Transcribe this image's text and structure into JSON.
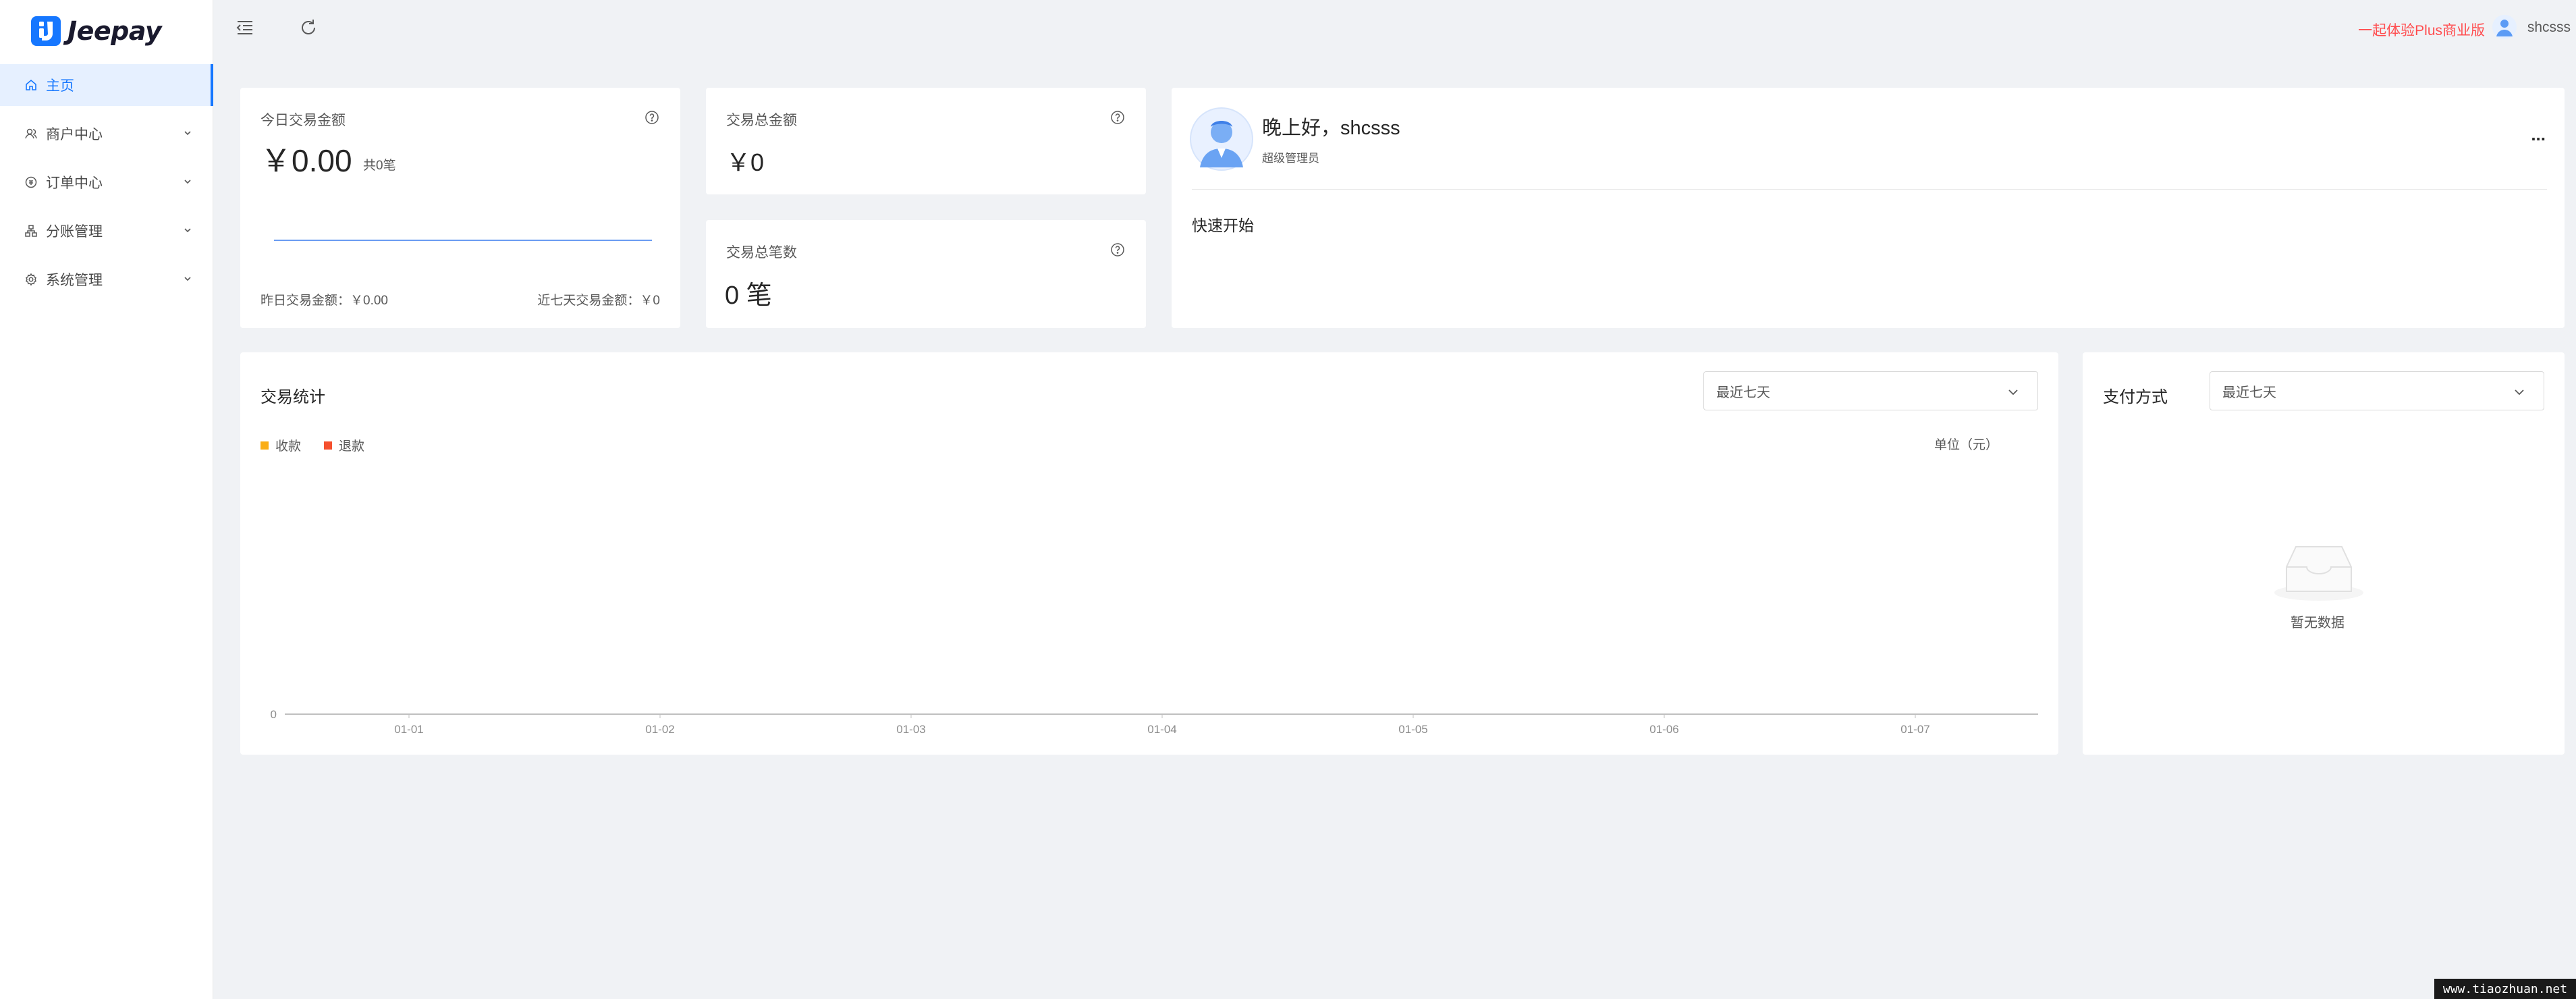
{
  "app": {
    "logo_text": "Jeepay",
    "brand_color": "#1677ff"
  },
  "sidebar": {
    "items": [
      {
        "label": "主页",
        "icon": "home-icon",
        "active": true
      },
      {
        "label": "商户中心",
        "icon": "merchant-icon",
        "expandable": true
      },
      {
        "label": "订单中心",
        "icon": "order-icon",
        "expandable": true
      },
      {
        "label": "分账管理",
        "icon": "division-icon",
        "expandable": true
      },
      {
        "label": "系统管理",
        "icon": "settings-icon",
        "expandable": true
      }
    ]
  },
  "header": {
    "promo_text": "一起体验Plus商业版",
    "username": "shcsss",
    "icons": [
      "menu-fold-icon",
      "refresh-icon"
    ]
  },
  "today_card": {
    "title": "今日交易金额",
    "amount": "￥0.00",
    "count": "共0笔",
    "yesterday": "昨日交易金额：￥0.00",
    "last7": "近七天交易金额：￥0"
  },
  "total_amount_card": {
    "title": "交易总金额",
    "value": "￥0"
  },
  "total_count_card": {
    "title": "交易总笔数",
    "value": "0 笔"
  },
  "welcome_card": {
    "greeting": "晚上好，shcsss",
    "role": "超级管理员",
    "more": "...",
    "quick_start": "快速开始"
  },
  "stats_card": {
    "title": "交易统计",
    "range": "最近七天",
    "unit": "单位（元）",
    "legend": [
      {
        "name": "收款",
        "color": "#faad14"
      },
      {
        "name": "退款",
        "color": "#f5502e"
      }
    ]
  },
  "chart_data": {
    "type": "line",
    "x": [
      "01-01",
      "01-02",
      "01-03",
      "01-04",
      "01-05",
      "01-06",
      "01-07"
    ],
    "y_tick_labels": [
      "0"
    ],
    "series": [
      {
        "name": "收款",
        "values": [
          0,
          0,
          0,
          0,
          0,
          0,
          0
        ]
      },
      {
        "name": "退款",
        "values": [
          0,
          0,
          0,
          0,
          0,
          0,
          0
        ]
      }
    ],
    "xlabel": "",
    "ylabel": ""
  },
  "pay_card": {
    "title": "支付方式",
    "range": "最近七天",
    "empty": "暂无数据"
  },
  "watermark": "www.tiaozhuan.net"
}
